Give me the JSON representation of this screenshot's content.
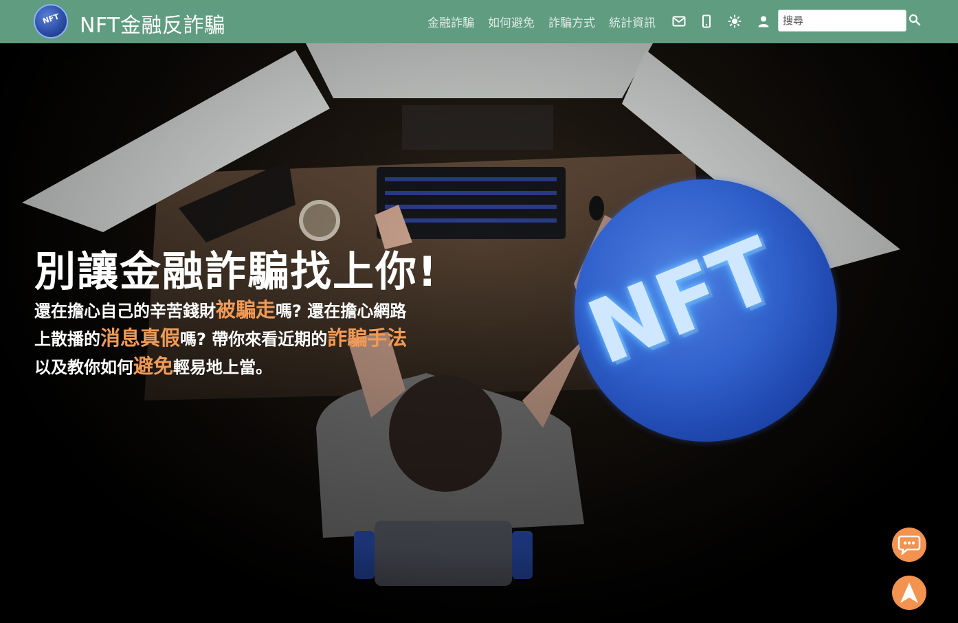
{
  "navbar": {
    "logo_text": "NFT",
    "brand": "NFT金融反詐騙",
    "links": [
      "金融詐騙",
      "如何避免",
      "詐騙方式",
      "統計資訊"
    ],
    "icons": [
      "mail-icon",
      "mobile-icon",
      "brightness-icon",
      "user-icon"
    ],
    "search_placeholder": "搜尋"
  },
  "hero": {
    "headline": "別讓金融詐騙找上你!",
    "paragraph": {
      "l1_a": "還在擔心自己的辛苦錢財",
      "l1_hl": "被騙走",
      "l1_b": "嗎? 還在擔心網路",
      "l2_a": "上散播的",
      "l2_hl1": "消息真假",
      "l2_b": "嗎? 帶你來看近期的",
      "l2_hl2": "詐騙手法",
      "l3_a": "以及教你如何",
      "l3_hl": "避免",
      "l3_b": "輕易地上當。"
    },
    "badge_text": "NFT"
  },
  "colors": {
    "navbar": "#5f9c80",
    "highlight": "#f29a56",
    "floating_button": "#f3934f"
  },
  "floating_buttons": [
    "chat-icon",
    "arrow-up-icon"
  ]
}
